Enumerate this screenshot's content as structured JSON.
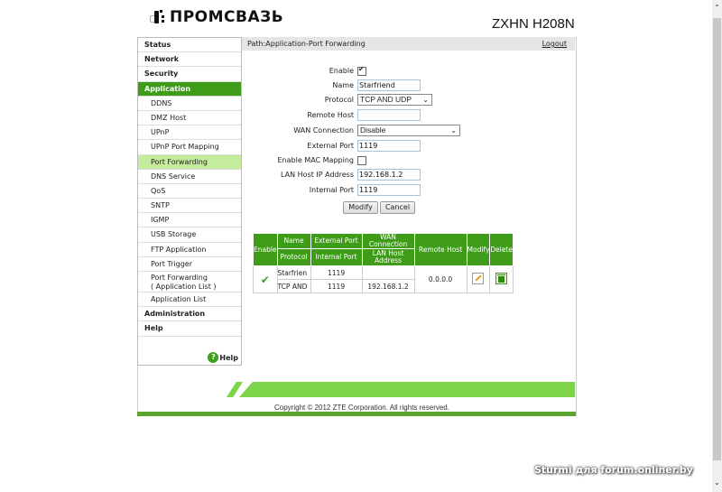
{
  "header": {
    "logo_text": "ПРОМСВАЗЬ",
    "model": "ZXHN H208N"
  },
  "sidebar": {
    "items": [
      {
        "label": "Status",
        "level": "top"
      },
      {
        "label": "Network",
        "level": "top"
      },
      {
        "label": "Security",
        "level": "top"
      },
      {
        "label": "Application",
        "level": "top",
        "active": true
      },
      {
        "label": "DDNS",
        "level": "sub"
      },
      {
        "label": "DMZ Host",
        "level": "sub"
      },
      {
        "label": "UPnP",
        "level": "sub"
      },
      {
        "label": "UPnP Port Mapping",
        "level": "sub"
      },
      {
        "label": "Port Forwarding",
        "level": "sub",
        "active": true
      },
      {
        "label": "DNS Service",
        "level": "sub"
      },
      {
        "label": "QoS",
        "level": "sub"
      },
      {
        "label": "SNTP",
        "level": "sub"
      },
      {
        "label": "IGMP",
        "level": "sub"
      },
      {
        "label": "USB Storage",
        "level": "sub"
      },
      {
        "label": "FTP Application",
        "level": "sub"
      },
      {
        "label": "Port Trigger",
        "level": "sub"
      },
      {
        "label": "Port Forwarding",
        "label2": "( Application List )",
        "level": "sub"
      },
      {
        "label": "Application List",
        "level": "sub"
      },
      {
        "label": "Administration",
        "level": "top"
      },
      {
        "label": "Help",
        "level": "top"
      }
    ],
    "help_label": "Help",
    "help_icon": "?"
  },
  "pathbar": {
    "path": "Path:Application-Port Forwarding",
    "logout": "Logout"
  },
  "form": {
    "enable_label": "Enable",
    "enable_checked": true,
    "name_label": "Name",
    "name_value": "Starfriend",
    "protocol_label": "Protocol",
    "protocol_value": "TCP AND UDP",
    "remote_host_label": "Remote Host",
    "remote_host_value": "",
    "wan_label": "WAN Connection",
    "wan_value": "Disable",
    "ext_port_label": "External Port",
    "ext_port_value": "1119",
    "mac_label": "Enable MAC Mapping",
    "mac_checked": false,
    "lan_ip_label": "LAN Host IP Address",
    "lan_ip_value": "192.168.1.2",
    "int_port_label": "Internal Port",
    "int_port_value": "1119",
    "modify_button": "Modify",
    "cancel_button": "Cancel"
  },
  "table": {
    "headers": {
      "enable": "Enable",
      "name": "Name",
      "protocol": "Protocol",
      "external_port": "External Port",
      "internal_port": "Internal Port",
      "wan_connection": "WAN Connection",
      "lan_host_address": "LAN Host Address",
      "remote_host": "Remote Host",
      "modify": "Modify",
      "delete": "Delete"
    },
    "rows": [
      {
        "enabled": true,
        "name": "Starfrien",
        "protocol": "TCP AND",
        "external_port": "1119",
        "internal_port": "1119",
        "wan_connection": "",
        "lan_host_address": "192.168.1.2",
        "remote_host": "0.0.0.0"
      }
    ]
  },
  "footer": {
    "copyright": "Copyright © 2012 ZTE Corporation. All rights reserved."
  },
  "watermark": "Sturmi для forum.onliner.by",
  "colors": {
    "accent_green": "#3f9c19",
    "active_sub_bg": "#c5ec9c",
    "stripe_green": "#7dd34a"
  }
}
